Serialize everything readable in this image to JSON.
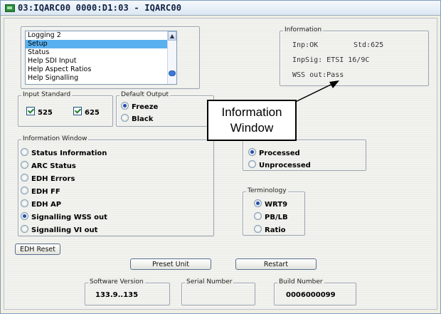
{
  "window": {
    "title": "03:IQARC00  0000:D1:03 - IQARC00"
  },
  "list": {
    "items": [
      "Logging 2",
      "Setup",
      "Status",
      "Help SDI Input",
      "Help Aspect Ratios",
      "Help Signalling"
    ],
    "selected_index": 1
  },
  "information": {
    "title": "Information",
    "inp": "Inp:OK",
    "std": "Std:625",
    "inpsig": "InpSig: ETSI 16/9C",
    "wss": "WSS out:Pass"
  },
  "input_standard": {
    "title": "Input Standard",
    "options": [
      {
        "label": "525",
        "checked": true
      },
      {
        "label": "625",
        "checked": true
      }
    ]
  },
  "default_output": {
    "title": "Default Output",
    "options": [
      {
        "label": "Freeze",
        "selected": true
      },
      {
        "label": "Black",
        "selected": false
      }
    ]
  },
  "information_window": {
    "title": "Information Window",
    "options": [
      {
        "label": "Status Information",
        "selected": false
      },
      {
        "label": "ARC Status",
        "selected": false
      },
      {
        "label": "EDH Errors",
        "selected": false
      },
      {
        "label": "EDH FF",
        "selected": false
      },
      {
        "label": "EDH AP",
        "selected": false
      },
      {
        "label": "Signalling WSS out",
        "selected": true
      },
      {
        "label": "Signalling VI out",
        "selected": false
      }
    ]
  },
  "processing": {
    "options": [
      {
        "label": "Processed",
        "selected": true
      },
      {
        "label": "Unprocessed",
        "selected": false
      }
    ]
  },
  "terminology": {
    "title": "Terminology",
    "options": [
      {
        "label": "WRT9",
        "selected": true
      },
      {
        "label": "PB/LB",
        "selected": false
      },
      {
        "label": "Ratio",
        "selected": false
      }
    ]
  },
  "buttons": {
    "edh_reset": "EDH Reset",
    "preset_unit": "Preset Unit",
    "restart": "Restart"
  },
  "software_version": {
    "title": "Software Version",
    "value": "133.9..135"
  },
  "serial_number": {
    "title": "Serial Number",
    "value": ""
  },
  "build_number": {
    "title": "Build Number",
    "value": "0006000099"
  },
  "callout": {
    "line1": "Information",
    "line2": "Window"
  },
  "colors": {
    "selection": "#59b0f0",
    "radio_dot": "#1f4fb0",
    "check_mark": "#1f7f2a"
  }
}
